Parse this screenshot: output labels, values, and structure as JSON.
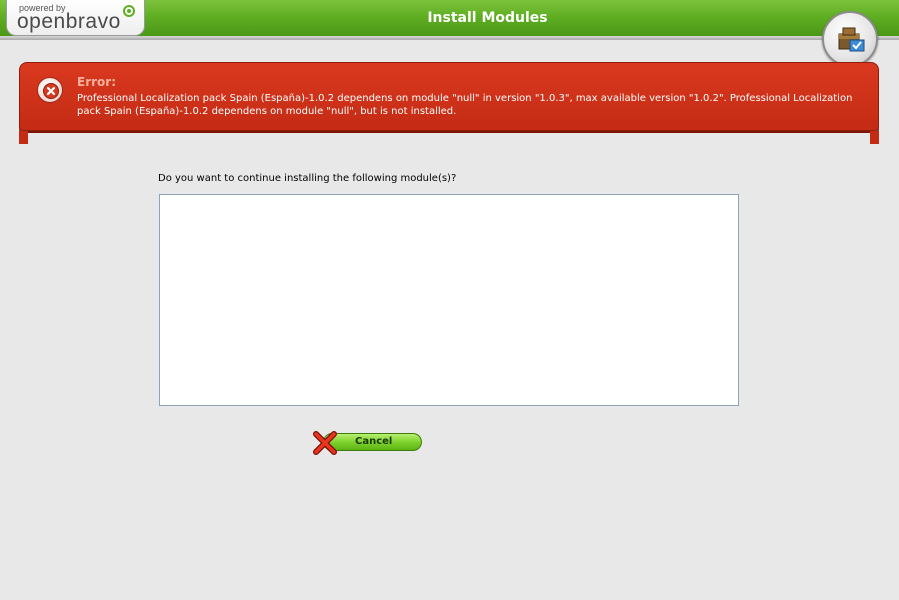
{
  "header": {
    "logo_powered": "powered by",
    "logo_name": "openbravo",
    "title": "Install Modules",
    "module_icon": "module-package-icon",
    "accent_color": "#5fae22"
  },
  "error": {
    "title": "Error:",
    "message": "Professional Localization pack Spain (España)-1.0.2 dependens on module \"null\" in version \"1.0.3\", max available version \"1.0.2\". Professional Localization pack Spain (España)-1.0.2 dependens on module \"null\", but is not installed.",
    "icon": "error-x-icon",
    "color": "#c42b14"
  },
  "main": {
    "question": "Do you want to continue installing the following module(s)?",
    "module_list_value": ""
  },
  "actions": {
    "cancel_label": "Cancel",
    "cancel_icon": "red-x-icon"
  }
}
